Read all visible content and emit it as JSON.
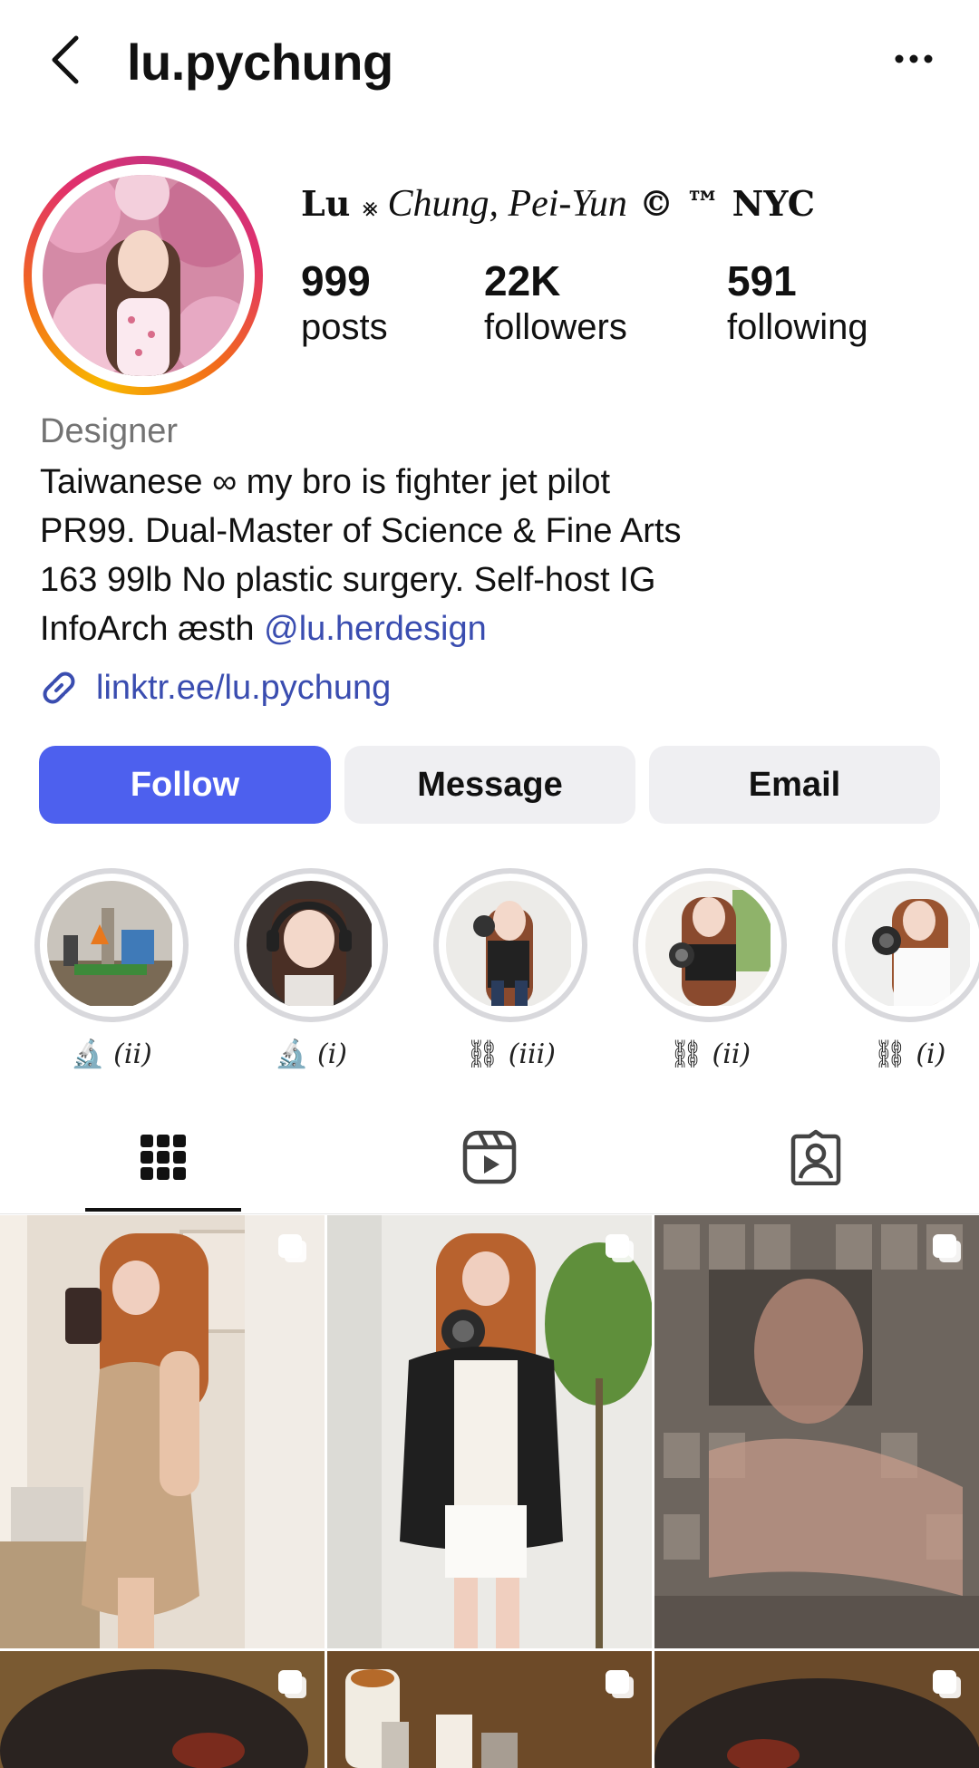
{
  "header": {
    "username": "lu.pychung"
  },
  "profile": {
    "display_name_parts": {
      "part1": "Lu ",
      "part2": "⨳",
      "part3": " Chung, Pei-Yun",
      "part4": " © ™ NYC"
    },
    "stats": {
      "posts_value": "999",
      "posts_label": "posts",
      "followers_value": "22K",
      "followers_label": "followers",
      "following_value": "591",
      "following_label": "following"
    },
    "category": "Designer",
    "bio": {
      "line1": "Taiwanese ∞ my bro is fighter jet pilot",
      "line2": "PR99. Dual-Master of Science & Fine Arts",
      "line3": "163 99lb No plastic surgery. Self-host IG",
      "line4_prefix": "InfoArch æsth ",
      "line4_mention": "@lu.herdesign"
    },
    "link": "linktr.ee/lu.pychung"
  },
  "actions": {
    "follow": "Follow",
    "message": "Message",
    "email": "Email"
  },
  "highlights": [
    {
      "emoji": "🔬",
      "label": "(ii)"
    },
    {
      "emoji": "🔬",
      "label": "(i)"
    },
    {
      "emoji": "⛓",
      "label": "(iii)"
    },
    {
      "emoji": "⛓",
      "label": "(ii)"
    },
    {
      "emoji": "⛓",
      "label": "(i)"
    }
  ],
  "icons": {
    "back": "chevron-left-icon",
    "more": "more-horizontal-icon",
    "link": "link-icon",
    "grid_tab": "grid-icon",
    "reels_tab": "reels-icon",
    "tagged_tab": "tagged-person-icon",
    "multi_post": "carousel-icon"
  },
  "colors": {
    "follow_button": "#4d60ee",
    "secondary_button": "#efeff2",
    "link": "#3a4db0",
    "category": "#737373"
  }
}
